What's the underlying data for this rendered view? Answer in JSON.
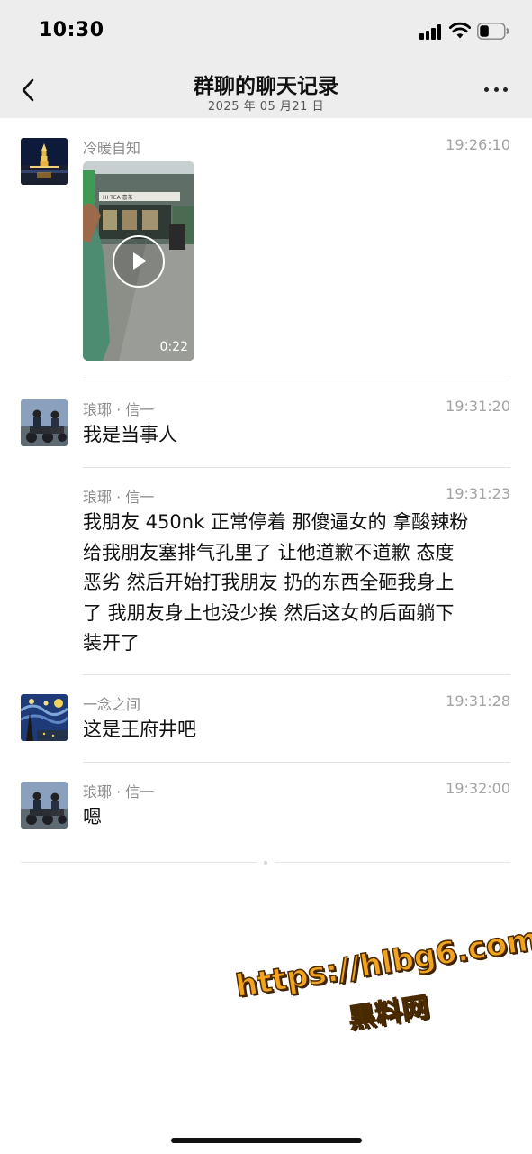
{
  "status_bar": {
    "time": "10:30"
  },
  "nav": {
    "title": "群聊的聊天记录",
    "subtitle": "2025 年 05 月21 日"
  },
  "messages": [
    {
      "sender": "冷暖自知",
      "time": "19:26:10",
      "type": "video",
      "duration": "0:22",
      "storefront_sign": "HI TEA 喜茶"
    },
    {
      "sender": "琅琊 · 信一",
      "time": "19:31:20",
      "type": "text",
      "text": "我是当事人"
    },
    {
      "sender": "琅琊 · 信一",
      "time": "19:31:23",
      "type": "text",
      "lines": [
        "我朋友 450nk 正常停着  那傻逼女的 拿酸辣粉",
        "给我朋友塞排气孔里了 让他道歉不道歉 态度",
        "恶劣 然后开始打我朋友  扔的东西全砸我身上",
        "了  我朋友身上也没少挨 然后这女的后面躺下",
        "装开了"
      ]
    },
    {
      "sender": "一念之间",
      "time": "19:31:28",
      "type": "text",
      "text": "这是王府井吧"
    },
    {
      "sender": "琅琊 · 信一",
      "time": "19:32:00",
      "type": "text",
      "text": "嗯"
    }
  ],
  "watermark": {
    "url": "https://hlbg6.com",
    "name": "黑料网"
  },
  "colors": {
    "background": "#ffffff",
    "header": "#ededed",
    "meta_text": "#8a8a8a",
    "time_text": "#a3a3a3",
    "watermark": "#f2a41f"
  },
  "icons": [
    "back-chevron-icon",
    "more-dots-icon",
    "signal-icon",
    "wifi-icon",
    "battery-icon",
    "play-icon"
  ]
}
